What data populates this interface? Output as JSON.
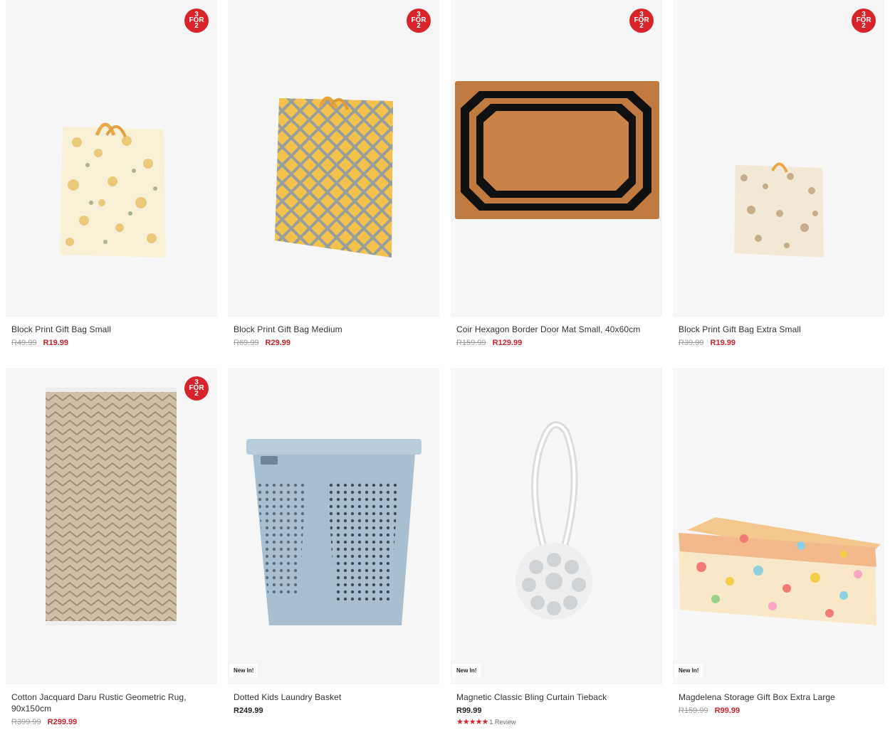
{
  "badge": {
    "line1": "3",
    "line2": "FOR",
    "line3": "2"
  },
  "new_tag": "New In!",
  "products": [
    {
      "title": "Block Print Gift Bag Small",
      "old_price": "R49.99",
      "price": "R19.99",
      "badge": true
    },
    {
      "title": "Block Print Gift Bag Medium",
      "old_price": "R69.99",
      "price": "R29.99",
      "badge": true
    },
    {
      "title": "Coir Hexagon Border Door Mat Small, 40x60cm",
      "old_price": "R159.99",
      "price": "R129.99",
      "badge": true
    },
    {
      "title": "Block Print Gift Bag Extra Small",
      "old_price": "R39.99",
      "price": "R19.99",
      "badge": true
    },
    {
      "title": "Cotton Jacquard Daru Rustic Geometric Rug, 90x150cm",
      "old_price": "R399.99",
      "price": "R299.99",
      "badge": true
    },
    {
      "title": "Dotted Kids Laundry Basket",
      "price": "R249.99",
      "new": true
    },
    {
      "title": "Magnetic Classic Bling Curtain Tieback",
      "price": "R99.99",
      "new": true,
      "stars": "★★★★★",
      "reviews": "1 Review"
    },
    {
      "title": "Magdelena Storage Gift Box Extra Large",
      "old_price": "R159.99",
      "price": "R99.99",
      "new": true
    }
  ],
  "colors": {
    "accent": "#d8232a",
    "card_bg": "#f6f6f6"
  }
}
